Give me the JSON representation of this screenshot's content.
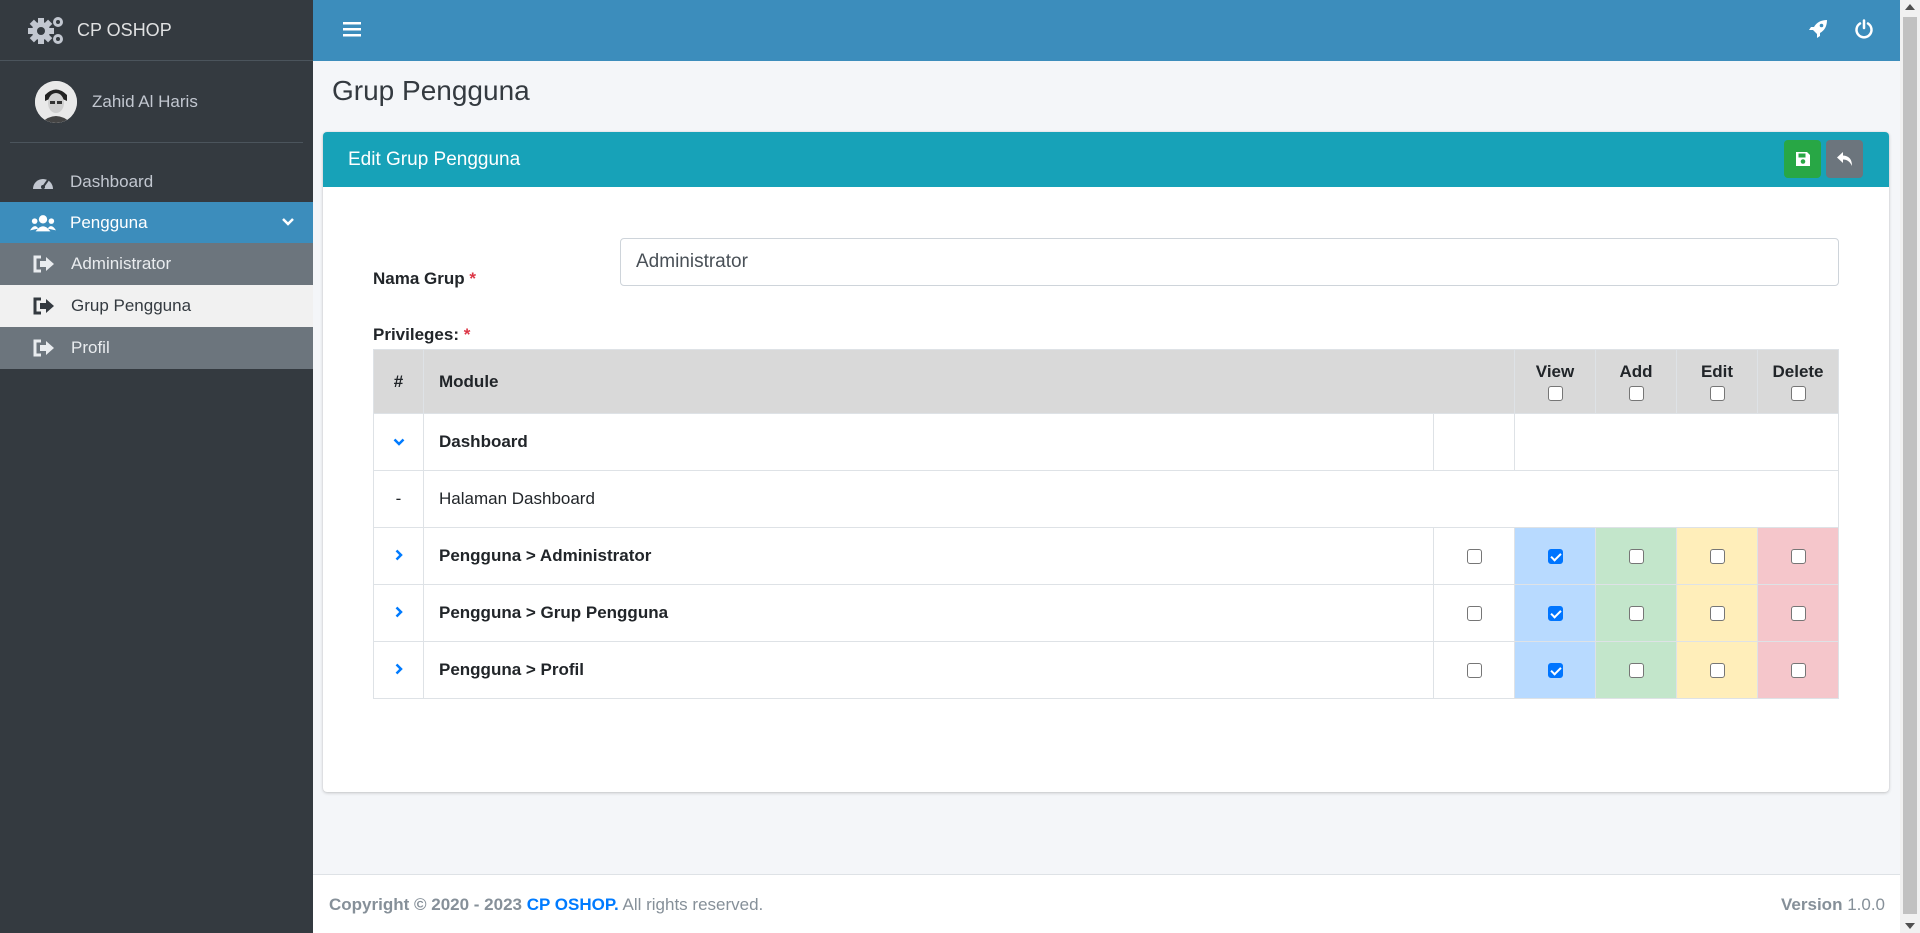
{
  "brand": {
    "name": "CP OSHOP",
    "logo_icon": "gears-icon"
  },
  "user": {
    "name": "Zahid Al Haris"
  },
  "sidebar": {
    "items": [
      {
        "label": "Dashboard",
        "icon": "tachometer-icon"
      },
      {
        "label": "Pengguna",
        "icon": "users-icon",
        "active": true
      }
    ],
    "subitems": [
      {
        "label": "Administrator",
        "icon": "sign-out-icon"
      },
      {
        "label": "Grup Pengguna",
        "icon": "sign-out-icon",
        "active": true
      },
      {
        "label": "Profil",
        "icon": "sign-out-icon"
      }
    ]
  },
  "topbar": {
    "menu_icon": "bars-icon",
    "right_icons": [
      "rocket-icon",
      "power-icon"
    ]
  },
  "page": {
    "title": "Grup Pengguna"
  },
  "card": {
    "title": "Edit Grup Pengguna",
    "save_icon": "floppy-icon",
    "back_icon": "reply-icon"
  },
  "form": {
    "group_label": "Nama Grup",
    "group_value": "Administrator",
    "privileges_label": "Privileges:",
    "required_mark": "*"
  },
  "table": {
    "headers": {
      "num": "#",
      "module": "Module",
      "view": "View",
      "add": "Add",
      "edit": "Edit",
      "delete": "Delete"
    },
    "rows": [
      {
        "toggle": "chevron-down-icon",
        "module": "Dashboard",
        "type": "parent"
      },
      {
        "toggle": "-",
        "module": "Halaman Dashboard",
        "type": "child"
      },
      {
        "toggle": "chevron-right-icon",
        "module": "Pengguna > Administrator",
        "type": "perm",
        "all": false,
        "view": true,
        "add": false,
        "edit": false,
        "delete": false
      },
      {
        "toggle": "chevron-right-icon",
        "module": "Pengguna > Grup Pengguna",
        "type": "perm",
        "all": false,
        "view": true,
        "add": false,
        "edit": false,
        "delete": false
      },
      {
        "toggle": "chevron-right-icon",
        "module": "Pengguna > Profil",
        "type": "perm",
        "all": false,
        "view": true,
        "add": false,
        "edit": false,
        "delete": false
      }
    ]
  },
  "footer": {
    "copyright_prefix": "Copyright © 2020 - 2023",
    "brand": "CP OSHOP.",
    "rights": "All rights reserved.",
    "version_label": "Version",
    "version": "1.0.0"
  },
  "colors": {
    "sidebar": "#343a40",
    "topbar": "#3c8dbc",
    "card_header": "#17a2b8",
    "save": "#28a745",
    "back": "#6c757d"
  }
}
